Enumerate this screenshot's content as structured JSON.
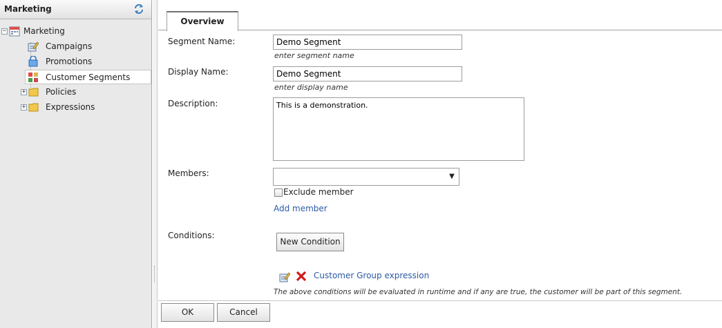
{
  "sidebar": {
    "title": "Marketing",
    "refresh_icon": "refresh-icon",
    "items": [
      {
        "label": "Marketing",
        "icon": "calendar-icon",
        "expander": "−"
      },
      {
        "label": "Campaigns",
        "icon": "edit-document-icon"
      },
      {
        "label": "Promotions",
        "icon": "shopping-bag-icon"
      },
      {
        "label": "Customer Segments",
        "icon": "segments-icon"
      },
      {
        "label": "Policies",
        "icon": "folder-icon",
        "expander": "+"
      },
      {
        "label": "Expressions",
        "icon": "folder-icon",
        "expander": "+"
      }
    ]
  },
  "tabs": [
    {
      "label": "Overview"
    }
  ],
  "form": {
    "segment_name": {
      "label": "Segment Name:",
      "value": "Demo Segment",
      "hint": "enter segment name"
    },
    "display_name": {
      "label": "Display Name:",
      "value": "Demo Segment",
      "hint": "enter display name"
    },
    "description": {
      "label": "Description:",
      "value": "This is a demonstration."
    },
    "members": {
      "label": "Members:",
      "value": "",
      "exclude_label": "Exclude member",
      "add_label": "Add member"
    },
    "conditions": {
      "label": "Conditions:",
      "new_button": "New Condition",
      "items": [
        {
          "label": "Customer Group expression"
        }
      ],
      "note": "The above conditions will be evaluated in runtime and if any are true, the customer will be part of this segment."
    }
  },
  "buttons": {
    "ok": "OK",
    "cancel": "Cancel"
  },
  "colors": {
    "link": "#2a5aa5",
    "delete": "#d11a1a",
    "folder": "#f2c84b"
  }
}
